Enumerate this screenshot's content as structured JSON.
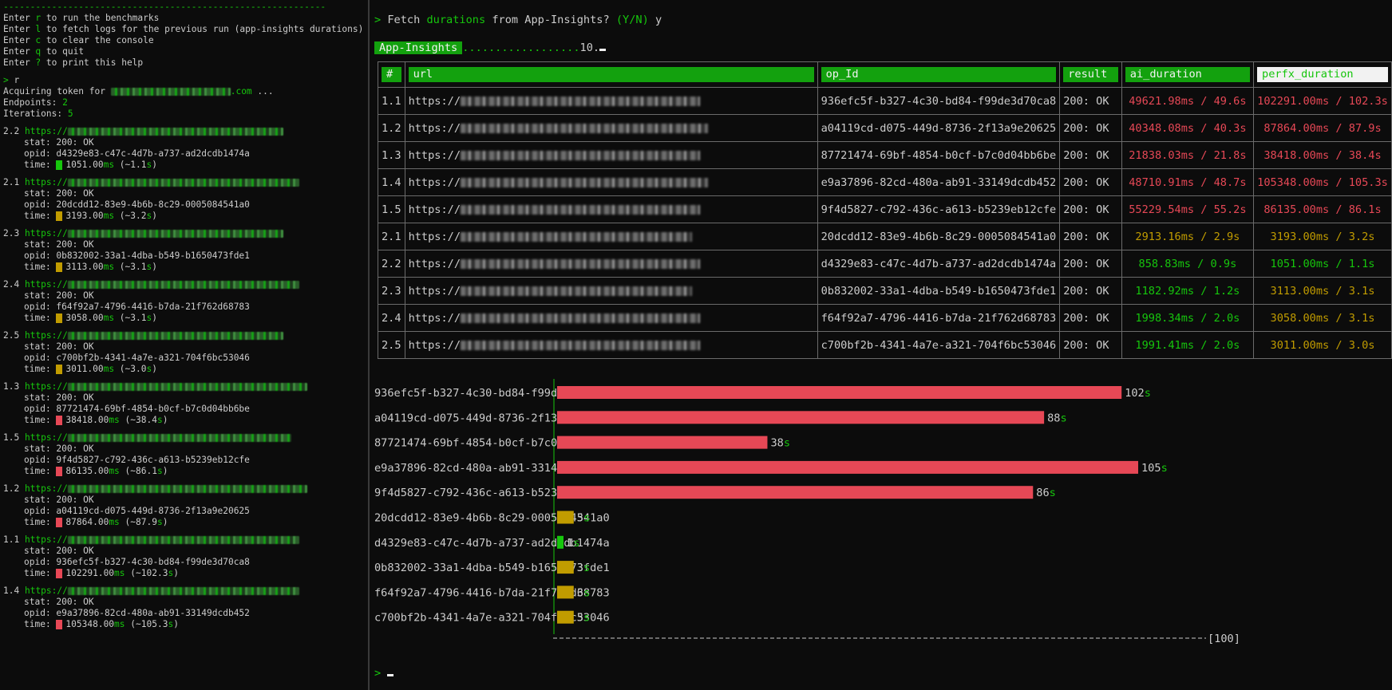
{
  "help": {
    "separator": "------------------------------------------------------------",
    "lines": [
      {
        "pre": "Enter ",
        "key": "r",
        "post": " to run the benchmarks"
      },
      {
        "pre": "Enter ",
        "key": "l",
        "post": " to fetch logs for the previous run (app-insights durations)"
      },
      {
        "pre": "Enter ",
        "key": "c",
        "post": " to clear the console"
      },
      {
        "pre": "Enter ",
        "key": "q",
        "post": " to quit"
      },
      {
        "pre": "Enter ",
        "key": "?",
        "post": " to print this help"
      }
    ]
  },
  "session": {
    "prompt": ">",
    "command": "r",
    "acquiring_pre": "Acquiring token for ",
    "acquiring_domain": ".com",
    "acquiring_post": " ...",
    "endpoints_label": "Endpoints: ",
    "endpoints_value": "2",
    "iterations_label": "Iterations: ",
    "iterations_value": "5"
  },
  "runs": [
    {
      "id": "2.2",
      "url": "https://",
      "stat": "200: OK",
      "opid": "d4329e83-c47c-4d7b-a737-ad2dcdb1474a",
      "ms": "1051.00",
      "approx": "1.1",
      "level": "g"
    },
    {
      "id": "2.1",
      "url": "https://",
      "stat": "200: OK",
      "opid": "20dcdd12-83e9-4b6b-8c29-0005084541a0",
      "ms": "3193.00",
      "approx": "3.2",
      "level": "y"
    },
    {
      "id": "2.3",
      "url": "https://",
      "stat": "200: OK",
      "opid": "0b832002-33a1-4dba-b549-b1650473fde1",
      "ms": "3113.00",
      "approx": "3.1",
      "level": "y"
    },
    {
      "id": "2.4",
      "url": "https://",
      "stat": "200: OK",
      "opid": "f64f92a7-4796-4416-b7da-21f762d68783",
      "ms": "3058.00",
      "approx": "3.1",
      "level": "y"
    },
    {
      "id": "2.5",
      "url": "https://",
      "stat": "200: OK",
      "opid": "c700bf2b-4341-4a7e-a321-704f6bc53046",
      "ms": "3011.00",
      "approx": "3.0",
      "level": "y"
    },
    {
      "id": "1.3",
      "url": "https://",
      "stat": "200: OK",
      "opid": "87721474-69bf-4854-b0cf-b7c0d04bb6be",
      "ms": "38418.00",
      "approx": "38.4",
      "level": "r"
    },
    {
      "id": "1.5",
      "url": "https://",
      "stat": "200: OK",
      "opid": "9f4d5827-c792-436c-a613-b5239eb12cfe",
      "ms": "86135.00",
      "approx": "86.1",
      "level": "r"
    },
    {
      "id": "1.2",
      "url": "https://",
      "stat": "200: OK",
      "opid": "a04119cd-d075-449d-8736-2f13a9e20625",
      "ms": "87864.00",
      "approx": "87.9",
      "level": "r"
    },
    {
      "id": "1.1",
      "url": "https://",
      "stat": "200: OK",
      "opid": "936efc5f-b327-4c30-bd84-f99de3d70ca8",
      "ms": "102291.00",
      "approx": "102.3",
      "level": "r"
    },
    {
      "id": "1.4",
      "url": "https://",
      "stat": "200: OK",
      "opid": "e9a37896-82cd-480a-ab91-33149dcdb452",
      "ms": "105348.00",
      "approx": "105.3",
      "level": "r"
    }
  ],
  "run_labels": {
    "stat": "stat: ",
    "opid": "opid: ",
    "time": "time: ",
    "ms_unit": "ms",
    "approx_open": " (~",
    "s_unit": "s",
    "approx_close": ")"
  },
  "fetch": {
    "prompt": ">",
    "pre": " Fetch ",
    "highlight": "durations",
    "post": " from App-Insights? ",
    "yn": "(Y/N)",
    "answer": " y"
  },
  "progress": {
    "badge": "App-Insights",
    "dots": "..................",
    "count": "10."
  },
  "table": {
    "headers": [
      "#",
      "url",
      "op_Id",
      "result",
      "ai_duration",
      "perfx_duration"
    ],
    "rows": [
      {
        "n": "1.1",
        "url": "https://",
        "op": "936efc5f-b327-4c30-bd84-f99de3d70ca8",
        "result": "200: OK",
        "ai": "49621.98ms / 49.6s",
        "perfx": "102291.00ms / 102.3s",
        "ai_c": "red",
        "pf_c": "red"
      },
      {
        "n": "1.2",
        "url": "https://",
        "op": "a04119cd-d075-449d-8736-2f13a9e20625",
        "result": "200: OK",
        "ai": "40348.08ms / 40.3s",
        "perfx": "87864.00ms / 87.9s",
        "ai_c": "red",
        "pf_c": "red"
      },
      {
        "n": "1.3",
        "url": "https://",
        "op": "87721474-69bf-4854-b0cf-b7c0d04bb6be",
        "result": "200: OK",
        "ai": "21838.03ms / 21.8s",
        "perfx": "38418.00ms / 38.4s",
        "ai_c": "red",
        "pf_c": "red"
      },
      {
        "n": "1.4",
        "url": "https://",
        "op": "e9a37896-82cd-480a-ab91-33149dcdb452",
        "result": "200: OK",
        "ai": "48710.91ms / 48.7s",
        "perfx": "105348.00ms / 105.3s",
        "ai_c": "red",
        "pf_c": "red"
      },
      {
        "n": "1.5",
        "url": "https://",
        "op": "9f4d5827-c792-436c-a613-b5239eb12cfe",
        "result": "200: OK",
        "ai": "55229.54ms / 55.2s",
        "perfx": "86135.00ms / 86.1s",
        "ai_c": "red",
        "pf_c": "red"
      },
      {
        "n": "2.1",
        "url": "https://",
        "op": "20dcdd12-83e9-4b6b-8c29-0005084541a0",
        "result": "200: OK",
        "ai": "2913.16ms / 2.9s",
        "perfx": "3193.00ms / 3.2s",
        "ai_c": "yel",
        "pf_c": "yel"
      },
      {
        "n": "2.2",
        "url": "https://",
        "op": "d4329e83-c47c-4d7b-a737-ad2dcdb1474a",
        "result": "200: OK",
        "ai": "858.83ms / 0.9s",
        "perfx": "1051.00ms / 1.1s",
        "ai_c": "grn",
        "pf_c": "grn"
      },
      {
        "n": "2.3",
        "url": "https://",
        "op": "0b832002-33a1-4dba-b549-b1650473fde1",
        "result": "200: OK",
        "ai": "1182.92ms / 1.2s",
        "perfx": "3113.00ms / 3.1s",
        "ai_c": "grn",
        "pf_c": "yel"
      },
      {
        "n": "2.4",
        "url": "https://",
        "op": "f64f92a7-4796-4416-b7da-21f762d68783",
        "result": "200: OK",
        "ai": "1998.34ms / 2.0s",
        "perfx": "3058.00ms / 3.1s",
        "ai_c": "grn",
        "pf_c": "yel"
      },
      {
        "n": "2.5",
        "url": "https://",
        "op": "c700bf2b-4341-4a7e-a321-704f6bc53046",
        "result": "200: OK",
        "ai": "1991.41ms / 2.0s",
        "perfx": "3011.00ms / 3.0s",
        "ai_c": "grn",
        "pf_c": "yel"
      }
    ]
  },
  "colors": {
    "green": "#16c60c",
    "yellow": "#c19c00",
    "red": "#e74856",
    "header_bg": "#13a10e"
  },
  "chart_data": {
    "type": "bar",
    "orientation": "horizontal",
    "categories": [
      "936efc5f-b327-4c30-bd84-f99de3d70ca8",
      "a04119cd-d075-449d-8736-2f13a9e20625",
      "87721474-69bf-4854-b0cf-b7c0d04bb6be",
      "e9a37896-82cd-480a-ab91-33149dcdb452",
      "9f4d5827-c792-436c-a613-b5239eb12cfe",
      "20dcdd12-83e9-4b6b-8c29-0005084541a0",
      "d4329e83-c47c-4d7b-a737-ad2dcdb1474a",
      "0b832002-33a1-4dba-b549-b1650473fde1",
      "f64f92a7-4796-4416-b7da-21f762d68783",
      "c700bf2b-4341-4a7e-a321-704f6bc53046"
    ],
    "values": [
      102,
      88,
      38,
      105,
      86,
      3,
      1,
      3,
      3,
      3
    ],
    "value_labels": [
      "102",
      "88",
      "38",
      "105",
      "86",
      "3",
      "1",
      "3",
      "3",
      "3"
    ],
    "unit": "s",
    "bar_colors": [
      "red",
      "red",
      "red",
      "red",
      "red",
      "yellow",
      "green",
      "yellow",
      "yellow",
      "yellow"
    ],
    "xlim": [
      0,
      105
    ],
    "scale_label": "[100]",
    "title": "",
    "xlabel": "",
    "ylabel": ""
  },
  "bottom_prompt": ">"
}
